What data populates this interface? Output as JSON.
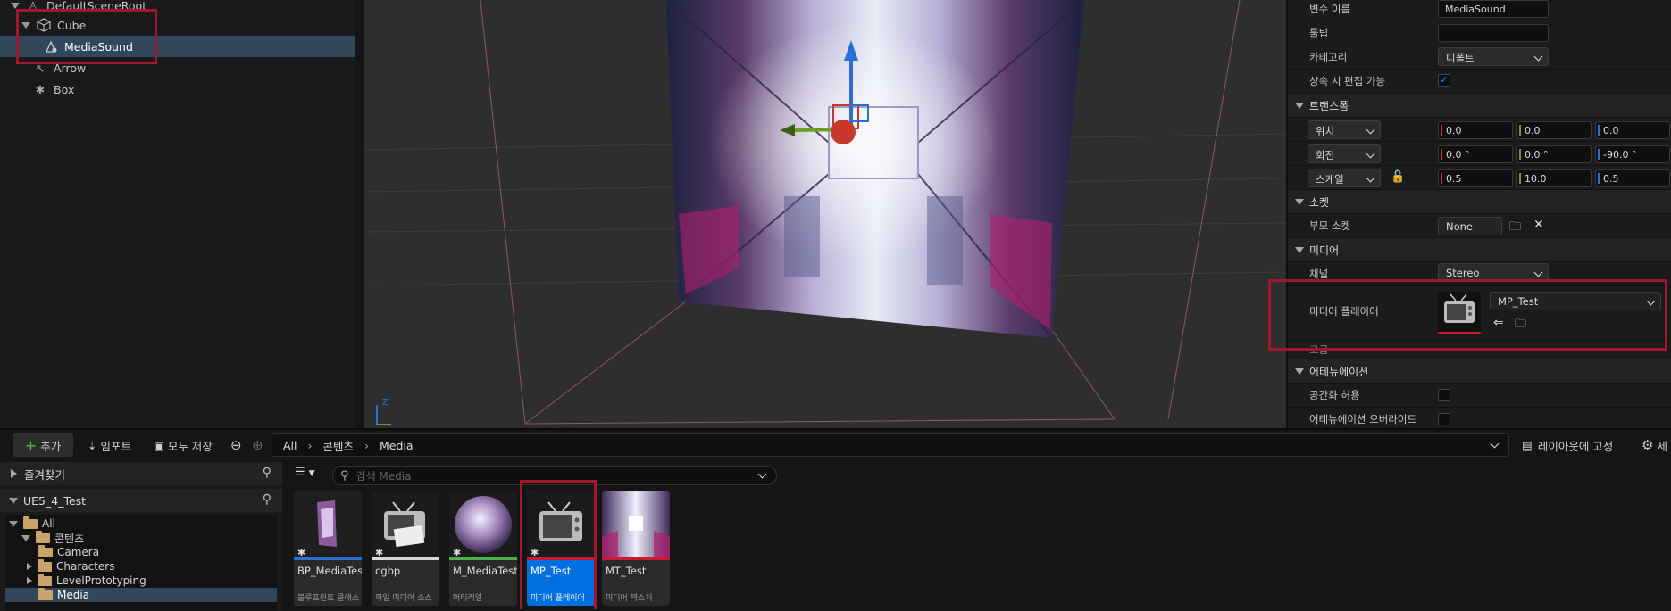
{
  "outliner": {
    "items": [
      {
        "label": "DefaultSceneRoot"
      },
      {
        "label": "Cube"
      },
      {
        "label": "MediaSound"
      },
      {
        "label": "Arrow"
      },
      {
        "label": "Box"
      }
    ]
  },
  "viewport": {
    "axis_label": "Z"
  },
  "details": {
    "var_name_label": "변수 이름",
    "var_name_value": "MediaSound",
    "tooltip_label": "툴팁",
    "tooltip_value": "",
    "category_label": "카테고리",
    "category_value": "디폴트",
    "editable_label": "상속 시 편집 가능",
    "transform_header": "트랜스폼",
    "location_label": "위치",
    "location_values": [
      "0.0",
      "0.0",
      "0.0"
    ],
    "rotation_label": "회전",
    "rotation_values": [
      "0.0 °",
      "0.0 °",
      "-90.0 °"
    ],
    "scale_label": "스케일",
    "scale_values": [
      "0.5",
      "10.0",
      "0.5"
    ],
    "socket_header": "소켓",
    "parent_socket_label": "부모 소켓",
    "parent_socket_value": "None",
    "media_header": "미디어",
    "channel_label": "채널",
    "channel_value": "Stereo",
    "media_player_label": "미디어 플레이어",
    "media_player_value": "MP_Test",
    "advanced_label": "고급",
    "attenuation_header": "어테뉴에이션",
    "spatialize_label": "공간화 허용",
    "attenuation_override_label": "어테뉴에이션 오버라이드"
  },
  "toolbar": {
    "add_label": "추가",
    "import_label": "임포트",
    "save_all_label": "모두 저장",
    "breadcrumb": [
      "All",
      "콘텐츠",
      "Media"
    ],
    "dock_label": "레이아웃에 고정",
    "settings_label": "세"
  },
  "sidebar": {
    "favorites_label": "즐겨찾기",
    "project_label": "UE5_4_Test",
    "tree": [
      {
        "label": "All"
      },
      {
        "label": "콘텐츠"
      },
      {
        "label": "Camera"
      },
      {
        "label": "Characters"
      },
      {
        "label": "LevelPrototyping"
      },
      {
        "label": "Media"
      }
    ]
  },
  "search": {
    "placeholder": "검색 Media"
  },
  "assets": [
    {
      "name": "BP_MediaTest",
      "type": "블루프린트 클래스"
    },
    {
      "name": "cgbp",
      "type": "파일 미디어 소스"
    },
    {
      "name": "M_MediaTest",
      "type": "머티리얼"
    },
    {
      "name": "MP_Test",
      "type": "미디어 플레이어"
    },
    {
      "name": "MT_Test",
      "type": "미디어 텍스처"
    }
  ],
  "colors": {
    "accent": "#0070e0",
    "highlight_box": "#a3162f",
    "selection": "#33475c",
    "axis_x": "#c8382d",
    "axis_y": "#6aa023",
    "axis_z": "#2a6fd6"
  }
}
